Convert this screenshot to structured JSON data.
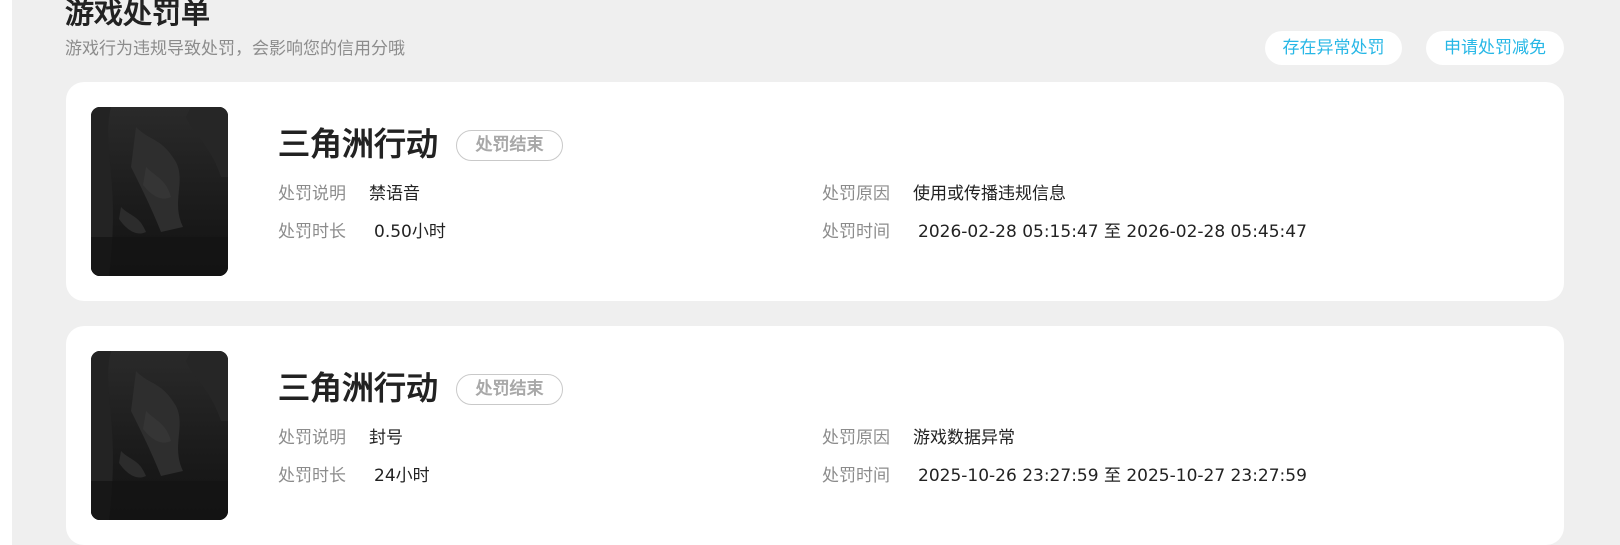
{
  "header": {
    "title": "游戏处罚单",
    "subtitle": "游戏行为违规导致处罚，会影响您的信用分哦",
    "abnormal_button": "存在异常处罚",
    "reduce_button": "申请处罚减免"
  },
  "labels": {
    "description": "处罚说明",
    "reason": "处罚原因",
    "duration": "处罚时长",
    "time": "处罚时间"
  },
  "records": [
    {
      "game": "三角洲行动",
      "status": "处罚结束",
      "description": "禁语音",
      "reason": "使用或传播违规信息",
      "duration": "0.50小时",
      "time": "2026-02-28 05:15:47 至 2026-02-28 05:45:47"
    },
    {
      "game": "三角洲行动",
      "status": "处罚结束",
      "description": "封号",
      "reason": "游戏数据异常",
      "duration": "24小时",
      "time": "2025-10-26 23:27:59 至 2025-10-27 23:27:59"
    }
  ]
}
